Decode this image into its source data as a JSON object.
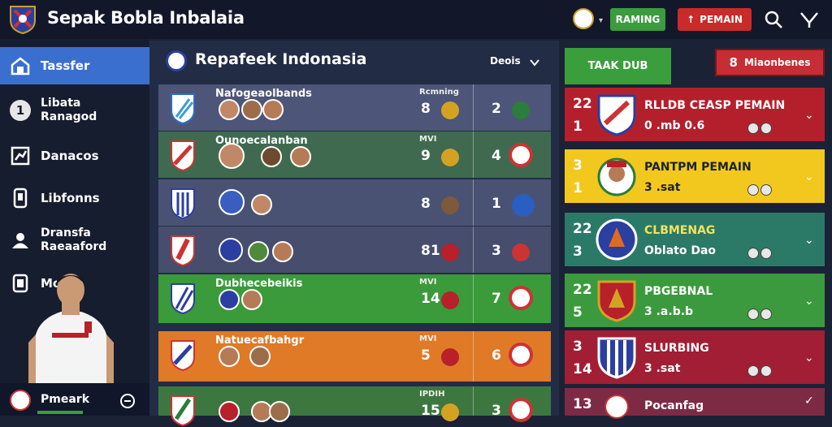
{
  "app": {
    "title": "Sepak Bobla Inbalaia"
  },
  "header": {
    "ranking_label": "RAMING",
    "pemain_label": "PEMAIN",
    "pemain_icon": "↑"
  },
  "sidebar": {
    "items": [
      {
        "label": "Tassfer",
        "icon": "home-icon"
      },
      {
        "label": "Libata\nRanagod",
        "icon": "number-one-icon"
      },
      {
        "label": "Danacos",
        "icon": "chart-icon"
      },
      {
        "label": "Libfonns",
        "icon": "phone-icon"
      },
      {
        "label": "Dransfa\nRaeaaford",
        "icon": "user-icon"
      },
      {
        "label": "Mo",
        "icon": "card-icon"
      }
    ],
    "footer_label": "Pmeark"
  },
  "main": {
    "title": "Repafeek Indonasia",
    "dropdown_label": "Deois",
    "rows": [
      {
        "name": "Nafogeaolbands",
        "col": "Rcmning",
        "n1": "8",
        "n2": "2",
        "color": "#4d5578"
      },
      {
        "name": "Ounoecalanban",
        "col": "MVI",
        "n1": "9",
        "n2": "4",
        "color": "#3f6a50"
      },
      {
        "name": "",
        "col": "",
        "n1": "8",
        "n2": "1",
        "color": "#4a5274"
      },
      {
        "name": "",
        "col": "",
        "n1": "81",
        "n2": "3",
        "color": "#464d6d"
      },
      {
        "name": "Dubhecebeikis",
        "col": "MVI",
        "n1": "14",
        "n2": "7",
        "color": "#3b9a3a"
      },
      {
        "name": "Natuecafbahgr",
        "col": "MVI",
        "n1": "5",
        "n2": "6",
        "color": "#e07a27"
      },
      {
        "name": "",
        "col": "IPDIH",
        "n1": "15",
        "n2": "3",
        "color": "#3c7740"
      }
    ]
  },
  "right": {
    "tab_club": "TAAK DUB",
    "tab_transfer": "Miaonbenes",
    "tab_transfer_icon": "8",
    "cards": [
      {
        "c1": "22",
        "c2": "1",
        "t1": "RLLDB CEASP PEMAIN",
        "t2": "0 .mb 0.6",
        "color": "#b3202c",
        "chev": "⌄"
      },
      {
        "c1": "3",
        "c2": "1",
        "t1": "PANTPM PEMAIN",
        "t2": "3 .sat",
        "color": "#f2c81e",
        "chev": "⌄"
      },
      {
        "c1": "22",
        "c2": "3",
        "t1": "CLBMENAG",
        "t2": "Oblato Dao",
        "color": "#2b7a68",
        "chev": "⌄"
      },
      {
        "c1": "22",
        "c2": "5",
        "t1": "PBGEBNAL",
        "t2": "3 .a.b.b",
        "color": "#3b9a3d",
        "chev": "⌄"
      },
      {
        "c1": "3",
        "c2": "14",
        "t1": "SLURBING",
        "t2": "3 .sat",
        "color": "#a11e35",
        "chev": "⌄"
      },
      {
        "c1": "13",
        "c2": "",
        "t1": "Pocanfag",
        "t2": "",
        "color": "#7d2a45",
        "chev": "✓"
      }
    ]
  }
}
